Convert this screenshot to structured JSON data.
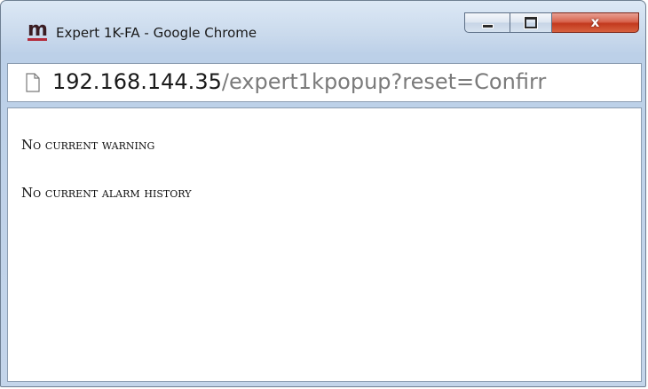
{
  "window": {
    "title": "Expert 1K-FA - Google Chrome",
    "app_logo_letter": "m",
    "close_label": "x"
  },
  "address": {
    "host": "192.168.144.35",
    "path": "/expert1kpopup?reset=Confirr"
  },
  "content": {
    "warning_text": "No current warning",
    "alarm_history_text": "No current alarm history"
  },
  "colors": {
    "logo_accent": "#b32b3a",
    "close_button": "#c3391e"
  }
}
